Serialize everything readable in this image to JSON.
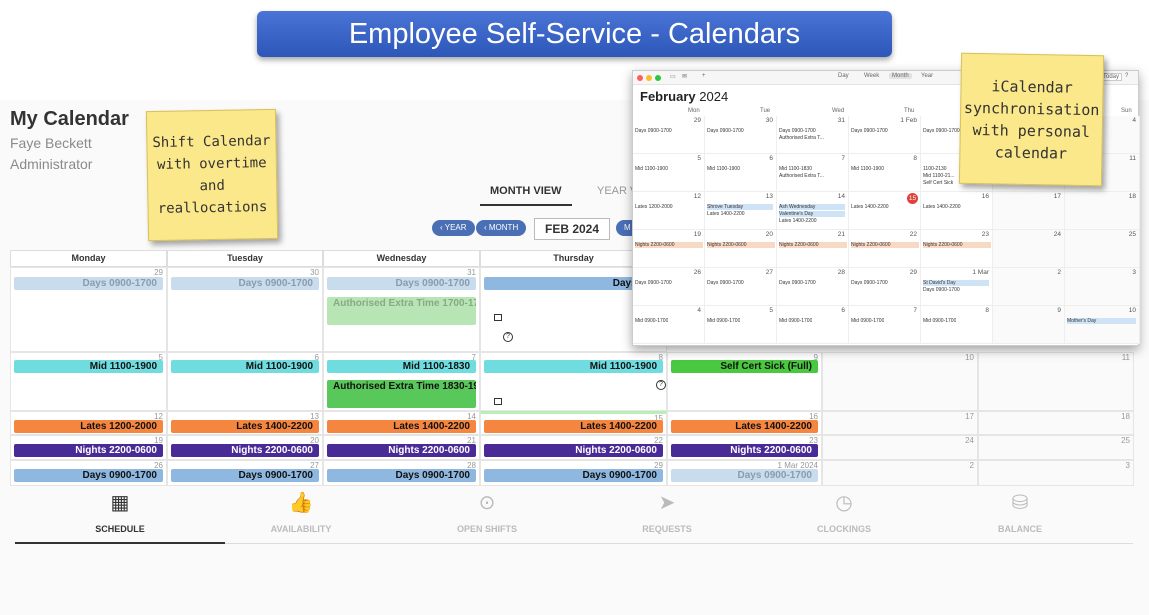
{
  "banner": {
    "title": "Employee Self-Service - Calendars"
  },
  "header": {
    "title": "My Calendar",
    "user_name": "Faye Beckett",
    "role": "Administrator"
  },
  "notes": {
    "shift": "Shift Calendar\nwith overtime\nand\nreallocations",
    "ical": "iCalendar\nsynchronisation\nwith personal\ncalendar"
  },
  "view_tabs": {
    "month": "MONTH VIEW",
    "year": "YEAR V"
  },
  "nav": {
    "year_btn": "YEAR",
    "month_btn": "MONTH",
    "current": "FEB 2024",
    "next_btn": "M"
  },
  "columns": [
    "Monday",
    "Tuesday",
    "Wednesday",
    "Thursday"
  ],
  "weeks": [
    {
      "days": [
        "29",
        "30",
        "31",
        "1",
        "",
        "",
        ""
      ]
    },
    {
      "days": [
        "5",
        "6",
        "7",
        "8",
        "9",
        "10",
        "11"
      ]
    },
    {
      "days": [
        "12",
        "13",
        "14",
        "15",
        "16",
        "17",
        "18"
      ]
    },
    {
      "days": [
        "19",
        "20",
        "21",
        "22",
        "23",
        "24",
        "25"
      ]
    },
    {
      "days": [
        "26",
        "27",
        "28",
        "29",
        "1   Mar 2024",
        "2",
        "3"
      ]
    }
  ],
  "events": {
    "w1": [
      "Days 0900-1700",
      "Days 0900-1700",
      "Days 0900-1700",
      "Days 0900-"
    ],
    "w1_extra": "Authorised Extra Time 1700-1730",
    "w2": [
      "Mid 1100-1900",
      "Mid 1100-1900",
      "Mid 1100-1830",
      "Mid 1100-1900",
      "Self Cert Sick (Full)"
    ],
    "w2_extra": "Authorised Extra Time 1830-1901",
    "w3": [
      "Lates 1200-2000",
      "Lates 1400-2200",
      "Lates 1400-2200",
      "Lates 1400-2200",
      "Lates 1400-2200"
    ],
    "w4": [
      "Nights 2200-0600",
      "Nights 2200-0600",
      "Nights 2200-0600",
      "Nights 2200-0600",
      "Nights 2200-0600"
    ],
    "w5": [
      "Days 0900-1700",
      "Days 0900-1700",
      "Days 0900-1700",
      "Days 0900-1700",
      "Days 0900-1700"
    ]
  },
  "bottom_nav": [
    "SCHEDULE",
    "AVAILABILITY",
    "OPEN SHIFTS",
    "REQUESTS",
    "CLOCKINGS",
    "BALANCE"
  ],
  "mac": {
    "view_tabs": [
      "Day",
      "Week",
      "Month",
      "Year"
    ],
    "today": "Today",
    "month": "February",
    "year": "2024",
    "dow": [
      "Mon",
      "Tue",
      "Wed",
      "Thu",
      "Fri",
      "Sat",
      "Sun"
    ],
    "rows": [
      {
        "n": [
          "29",
          "30",
          "31",
          "1 Feb",
          "",
          "",
          "4"
        ],
        "ev": [
          [
            "Days 0900-1700"
          ],
          [
            "Days 0900-1700"
          ],
          [
            "Days 0900-1700",
            "Authorised Extra T..."
          ],
          [
            "Days 0900-1700"
          ],
          [
            "Days 0900-1700"
          ],
          [],
          []
        ]
      },
      {
        "n": [
          "5",
          "6",
          "7",
          "8",
          "",
          "",
          "11"
        ],
        "ev": [
          [
            "Mid 1100-1900"
          ],
          [
            "Mid 1100-1900"
          ],
          [
            "Mid 1100-1830",
            "Authorised Extra T..."
          ],
          [
            "Mid 1100-1900"
          ],
          [
            "1100-2130",
            "Mid 1100-21...",
            "Self Cert Sick"
          ],
          [],
          []
        ]
      },
      {
        "n": [
          "12",
          "13",
          "14",
          "15",
          "16",
          "17",
          "18"
        ],
        "ev": [
          [
            "Lates 1200-2000"
          ],
          [
            "Shrove Tuesday",
            "Lates 1400-2200"
          ],
          [
            "Ash Wednesday",
            "Valentine's Day",
            "Lates 1400-2200"
          ],
          [
            "Lates 1400-2200"
          ],
          [
            "Lates 1400-2200"
          ],
          [],
          []
        ]
      },
      {
        "n": [
          "19",
          "20",
          "21",
          "22",
          "23",
          "24",
          "25"
        ],
        "ev": [
          [
            "Nights 2200-0600"
          ],
          [
            "Nights 2200-0600"
          ],
          [
            "Nights 2200-0600"
          ],
          [
            "Nights 2200-0600"
          ],
          [
            "Nights 2200-0600"
          ],
          [],
          []
        ]
      },
      {
        "n": [
          "26",
          "27",
          "28",
          "29",
          "1 Mar",
          "2",
          "3"
        ],
        "ev": [
          [
            "Days 0900-1700"
          ],
          [
            "Days 0900-1700"
          ],
          [
            "Days 0900-1700"
          ],
          [
            "Days 0900-1700"
          ],
          [
            "St David's Day",
            "Days 0900-1700"
          ],
          [],
          []
        ]
      },
      {
        "n": [
          "4",
          "5",
          "6",
          "7",
          "8",
          "9",
          "10"
        ],
        "ev": [
          [
            "Mid 0900-1700"
          ],
          [
            "Mid 0900-1700"
          ],
          [
            "Mid 0900-1700"
          ],
          [
            "Mid 0900-1700"
          ],
          [
            "Mid 0900-1700"
          ],
          [],
          [
            "Mother's Day"
          ]
        ]
      }
    ]
  },
  "colors": {
    "days": "#8fb8e0",
    "days_faded": "#c9dcee",
    "mid": "#6fdde0",
    "lates": "#f5863f",
    "nights": "#4a2a96",
    "extra": "#58c85a",
    "extra_faded": "#b7e6b4",
    "sick": "#49c840",
    "banner": "#3a63c7"
  }
}
